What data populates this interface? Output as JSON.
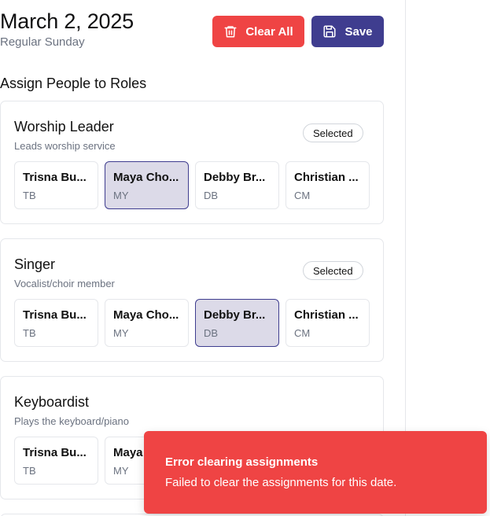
{
  "header": {
    "date": "March 2, 2025",
    "service_type": "Regular Sunday",
    "clear_all_label": "Clear All",
    "save_label": "Save",
    "clear_icon": "trash-icon",
    "save_icon": "floppy-disk-icon"
  },
  "section_title": "Assign People to Roles",
  "roles": [
    {
      "name": "Worship Leader",
      "description": "Leads worship service",
      "badge": "Selected",
      "people": [
        {
          "name": "Trisna Bu...",
          "initials": "TB",
          "selected": false
        },
        {
          "name": "Maya Cho...",
          "initials": "MY",
          "selected": true
        },
        {
          "name": "Debby Br...",
          "initials": "DB",
          "selected": false
        },
        {
          "name": "Christian ...",
          "initials": "CM",
          "selected": false
        }
      ]
    },
    {
      "name": "Singer",
      "description": "Vocalist/choir member",
      "badge": "Selected",
      "people": [
        {
          "name": "Trisna Bu...",
          "initials": "TB",
          "selected": false
        },
        {
          "name": "Maya Cho...",
          "initials": "MY",
          "selected": false
        },
        {
          "name": "Debby Br...",
          "initials": "DB",
          "selected": true
        },
        {
          "name": "Christian ...",
          "initials": "CM",
          "selected": false
        }
      ]
    },
    {
      "name": "Keyboardist",
      "description": "Plays the keyboard/piano",
      "badge": "",
      "people": [
        {
          "name": "Trisna Bu...",
          "initials": "TB",
          "selected": false
        },
        {
          "name": "Maya Cho...",
          "initials": "MY",
          "selected": false
        }
      ]
    }
  ],
  "toast": {
    "title": "Error clearing assignments",
    "message": "Failed to clear the assignments for this date."
  },
  "colors": {
    "danger": "#ef4444",
    "primary": "#3f3d8f",
    "selected_bg": "#dcdae8"
  }
}
